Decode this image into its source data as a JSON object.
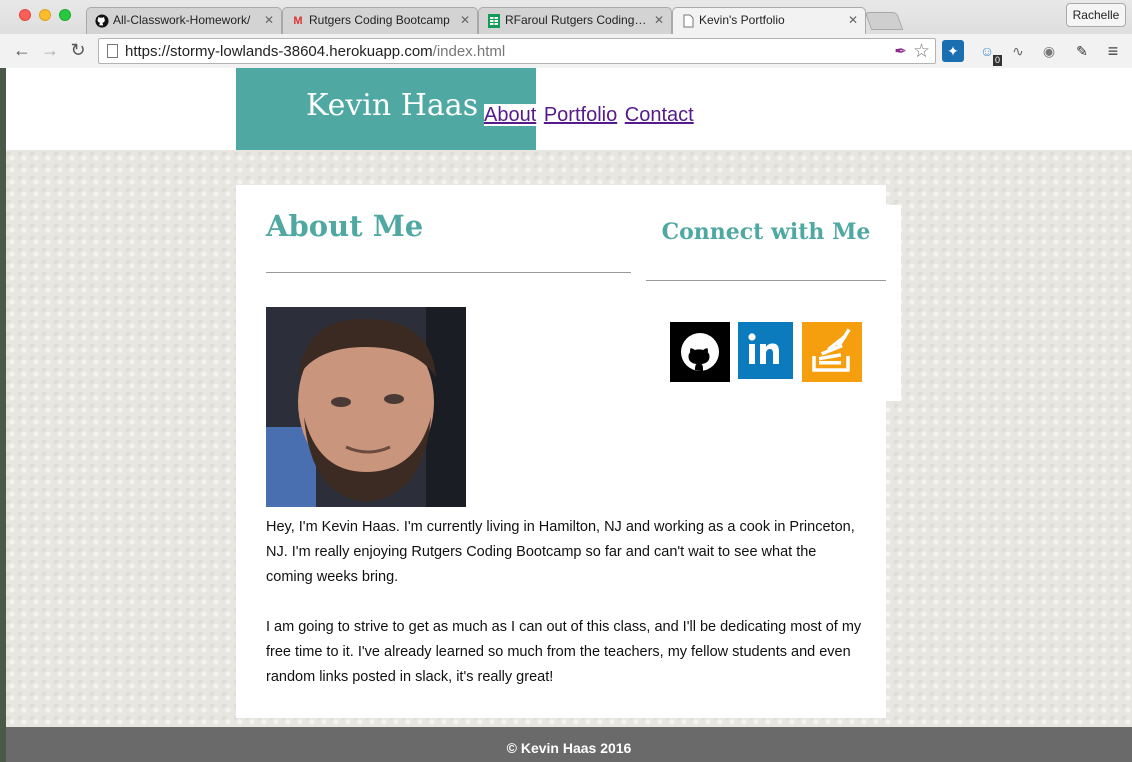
{
  "browser": {
    "tabs": [
      {
        "label": "All-Classwork-Homework/",
        "icon": "github-icon"
      },
      {
        "label": "Rutgers Coding Bootcamp",
        "icon": "gmail-icon"
      },
      {
        "label": "RFaroul Rutgers Coding Bo",
        "icon": "sheets-icon"
      },
      {
        "label": "Kevin's Portfolio",
        "icon": "page-icon"
      }
    ],
    "profile": "Rachelle",
    "url_host": "https://stormy-lowlands-38604.herokuapp.com",
    "url_path": "/index.html",
    "extension_badge": "0"
  },
  "site": {
    "brand": "Kevin Haas",
    "nav": {
      "about": "About",
      "portfolio": "Portfolio",
      "contact": "Contact"
    },
    "about": {
      "title": "About Me",
      "paragraphs": [
        "Hey, I'm Kevin Haas. I'm currently living in Hamilton, NJ and working as a cook in Princeton, NJ. I'm really enjoying Rutgers Coding Bootcamp so far and can't wait to see what the coming weeks bring.",
        "I am going to strive to get as much as I can out of this class, and I'll be dedicating most of my free time to it. I've already learned so much from the teachers, my fellow students and even random links posted in slack, it's really great!"
      ]
    },
    "connect": {
      "title": "Connect with Me",
      "links": [
        {
          "name": "github",
          "color": "#000000"
        },
        {
          "name": "linkedin",
          "color": "#0b7bbd"
        },
        {
          "name": "stackoverflow",
          "color": "#f69f0e"
        }
      ]
    },
    "footer": "© Kevin Haas 2016",
    "accent": "#4fa8a2"
  }
}
